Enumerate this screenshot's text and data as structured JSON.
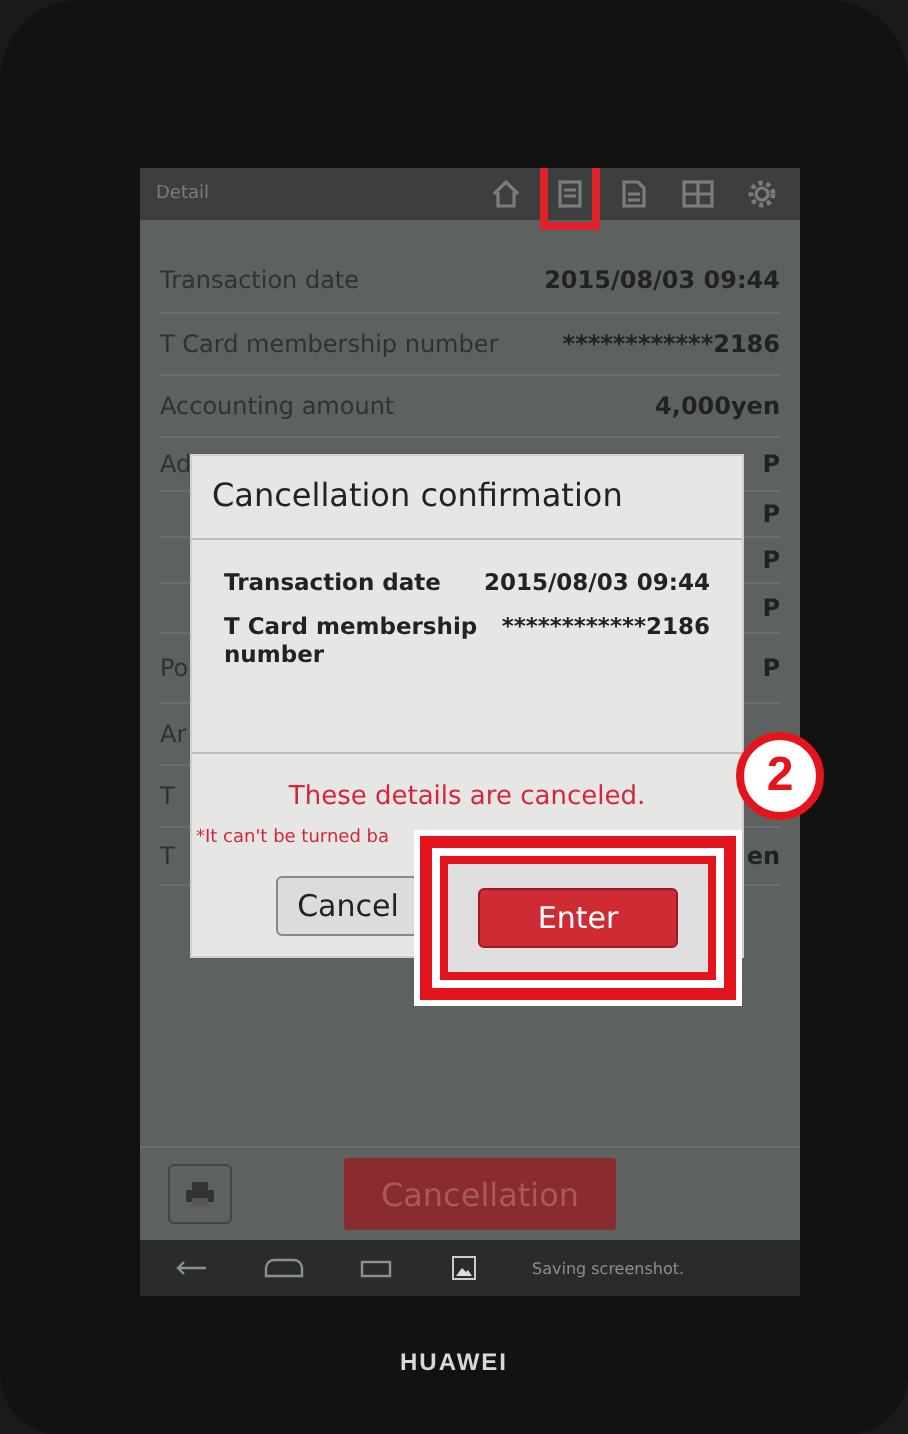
{
  "toolbar": {
    "title": "Detail",
    "icons": [
      {
        "kind": "home",
        "annotated": false
      },
      {
        "kind": "receipt",
        "annotated": true
      },
      {
        "kind": "document",
        "annotated": false
      },
      {
        "kind": "grid",
        "annotated": false
      },
      {
        "kind": "gear",
        "annotated": false
      }
    ]
  },
  "rows": [
    {
      "label": "Transaction date",
      "value": "2015/08/03 09:44"
    },
    {
      "label": "T Card membership number",
      "value": "************2186"
    },
    {
      "label": "Accounting amount",
      "value": "4,000yen"
    },
    {
      "label": "Ad",
      "value": "P"
    },
    {
      "value": "P"
    },
    {
      "value": "P"
    },
    {
      "value": "P"
    },
    {
      "label": "Po",
      "value": "P"
    },
    {
      "label": "Ar"
    },
    {
      "label": "T"
    },
    {
      "label": "T",
      "value": "en"
    }
  ],
  "dialog": {
    "title": "Cancellation confirmation",
    "details": [
      {
        "label": "Transaction date",
        "value": "2015/08/03 09:44"
      },
      {
        "label": "T Card membership number",
        "value": "************2186"
      }
    ],
    "message": "These details are canceled.",
    "warning": "*It can't be turned ba",
    "buttons": [
      {
        "label": "Cancel",
        "kind": "secondary"
      },
      {
        "label": "Enter",
        "kind": "primary",
        "annotated": true
      }
    ]
  },
  "step_badge": "2",
  "bottom": {
    "button": "Cancellation"
  },
  "navbar": {
    "notification": "Saving screenshot."
  },
  "brand": "HUAWEI"
}
